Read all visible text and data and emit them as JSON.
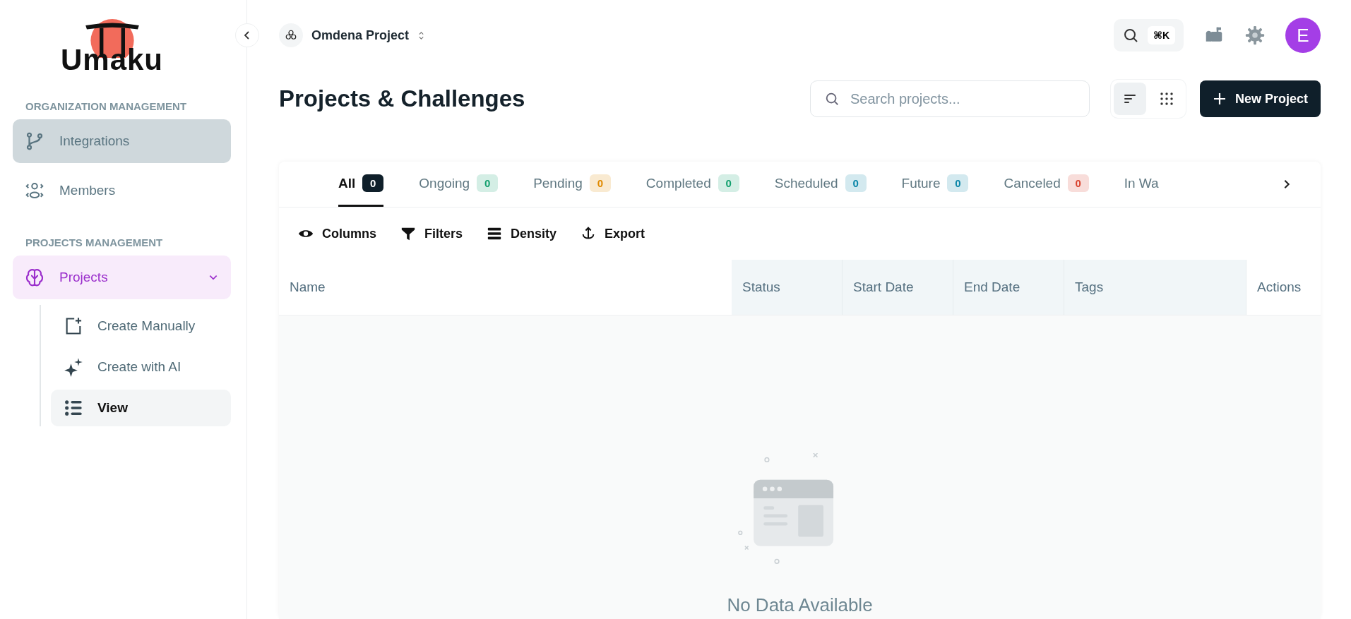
{
  "sidebar": {
    "logo": "Umaku",
    "sections": [
      {
        "heading": "ORGANIZATION MANAGEMENT",
        "items": [
          {
            "label": "Integrations",
            "hovered": true,
            "selected": false
          },
          {
            "label": "Members",
            "hovered": false,
            "selected": false
          }
        ]
      },
      {
        "heading": "PROJECTS MANAGEMENT",
        "items": [
          {
            "label": "Projects",
            "hovered": false,
            "selected": true,
            "expanded": true,
            "children": [
              {
                "label": "Create Manually",
                "selected": false
              },
              {
                "label": "Create with AI",
                "selected": false
              },
              {
                "label": "View",
                "selected": true
              }
            ]
          }
        ]
      }
    ]
  },
  "header": {
    "project": "Omdena Project",
    "shortcut": "⌘K",
    "avatar": "E"
  },
  "page": {
    "title": "Projects & Challenges",
    "search": {
      "placeholder": "Search projects..."
    },
    "view_modes": [
      {
        "selected": true
      },
      {
        "selected": false
      }
    ],
    "new_button": "New Project"
  },
  "tabs": [
    {
      "label": "All",
      "count": "0",
      "selected": true,
      "color": "#0f1f2a"
    },
    {
      "label": "Ongoing",
      "count": "0",
      "selected": false,
      "color": "#12a06e"
    },
    {
      "label": "Pending",
      "count": "0",
      "selected": false,
      "color": "#e08a00"
    },
    {
      "label": "Completed",
      "count": "0",
      "selected": false,
      "color": "#12a06e"
    },
    {
      "label": "Scheduled",
      "count": "0",
      "selected": false,
      "color": "#0a86a8"
    },
    {
      "label": "Future",
      "count": "0",
      "selected": false,
      "color": "#0a86a8"
    },
    {
      "label": "Canceled",
      "count": "0",
      "selected": false,
      "color": "#d9432f"
    },
    {
      "label": "In Wa",
      "selected": false
    }
  ],
  "toolbar": [
    "Columns",
    "Filters",
    "Density",
    "Export"
  ],
  "table": {
    "columns": [
      {
        "label": "Name",
        "pinned": false
      },
      {
        "label": "Status",
        "pinned": true
      },
      {
        "label": "Start Date",
        "pinned": true
      },
      {
        "label": "End Date",
        "pinned": true
      },
      {
        "label": "Tags",
        "pinned": true
      },
      {
        "label": "Actions",
        "pinned": false
      }
    ],
    "empty_message": "No Data Available"
  }
}
